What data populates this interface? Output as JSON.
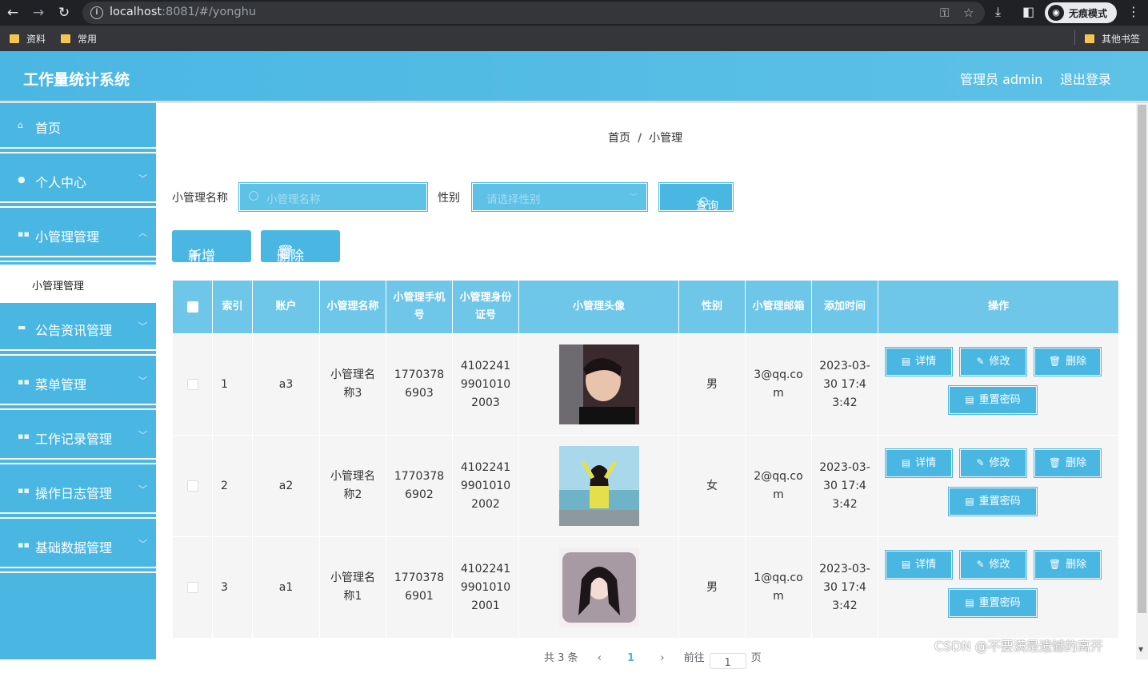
{
  "browser": {
    "url_host": "localhost",
    "url_rest": ":8081/#/yonghu",
    "incognito_label": "无痕模式",
    "bookmarks": [
      "资料",
      "常用"
    ],
    "other_bookmarks": "其他书签"
  },
  "header": {
    "title": "工作量统计系统",
    "admin_label": "管理员 admin",
    "logout_label": "退出登录"
  },
  "sidebar": {
    "items": [
      {
        "label": "首页",
        "icon": "home-icon"
      },
      {
        "label": "个人中心",
        "icon": "user-icon"
      },
      {
        "label": "小管理管理",
        "icon": "grid-icon"
      },
      {
        "label": "公告资讯管理",
        "icon": "briefcase-icon"
      },
      {
        "label": "菜单管理",
        "icon": "grid-icon"
      },
      {
        "label": "工作记录管理",
        "icon": "grid-icon"
      },
      {
        "label": "操作日志管理",
        "icon": "grid-icon"
      },
      {
        "label": "基础数据管理",
        "icon": "grid-icon"
      }
    ],
    "submenu_label": "小管理管理"
  },
  "breadcrumb": {
    "home": "首页",
    "current": "小管理"
  },
  "filters": {
    "name_label": "小管理名称",
    "name_placeholder": "小管理名称",
    "gender_label": "性别",
    "gender_placeholder": "请选择性别",
    "query_label": "查询"
  },
  "actions": {
    "add_label": "新增",
    "delete_label": "删除"
  },
  "table": {
    "columns": [
      "索引",
      "账户",
      "小管理名称",
      "小管理手机号",
      "小管理身份证号",
      "小管理头像",
      "性别",
      "小管理邮箱",
      "添加时间",
      "操作"
    ],
    "rows": [
      {
        "index": "1",
        "account": "a3",
        "name": "小管理名称3",
        "phone": "17703786903",
        "id_card": "410224199010102003",
        "gender": "男",
        "email": "3@qq.com",
        "time": "2023-03-30 17:43:42"
      },
      {
        "index": "2",
        "account": "a2",
        "name": "小管理名称2",
        "phone": "17703786902",
        "id_card": "410224199010102002",
        "gender": "女",
        "email": "2@qq.com",
        "time": "2023-03-30 17:43:42"
      },
      {
        "index": "3",
        "account": "a1",
        "name": "小管理名称1",
        "phone": "17703786901",
        "id_card": "410224199010102001",
        "gender": "男",
        "email": "1@qq.com",
        "time": "2023-03-30 17:43:42"
      }
    ],
    "ops": {
      "detail": "详情",
      "edit": "修改",
      "delete": "删除",
      "reset": "重置密码"
    }
  },
  "pager": {
    "total": "共 3 条",
    "page": "1",
    "goto": "前往",
    "goto_value": "1",
    "unit": "页"
  },
  "watermark": "CSDN @不要满是遗憾的离开",
  "colors": {
    "accent": "#4ab7e3",
    "header_cell": "#6ec6e8",
    "row_bg": "#f5f5f5"
  }
}
